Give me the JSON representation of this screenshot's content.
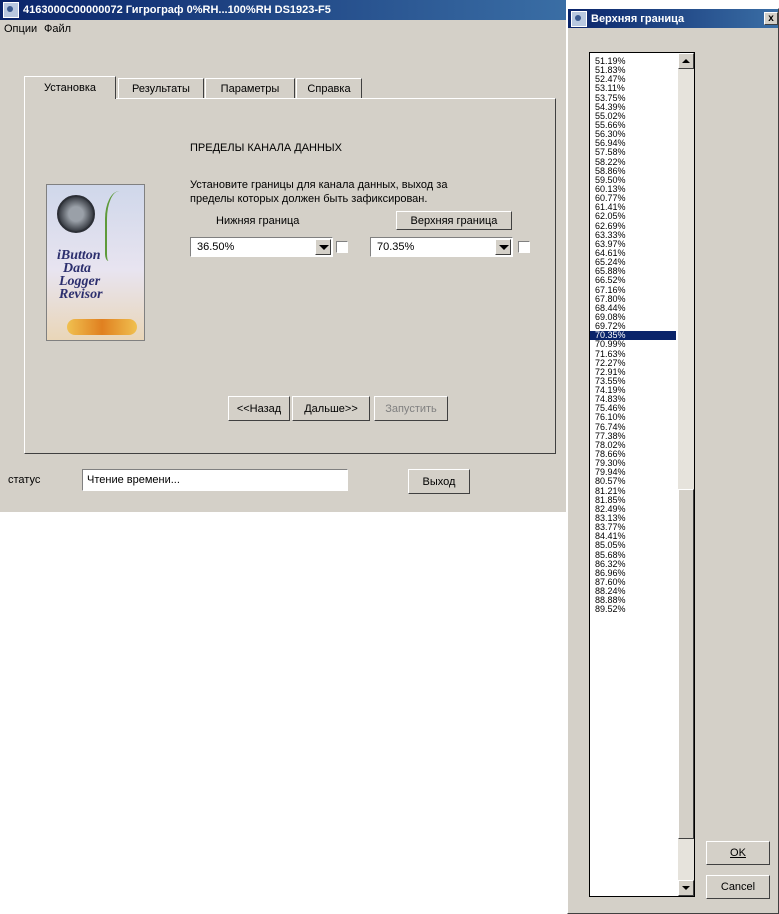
{
  "main_window": {
    "title": "4163000C00000072   Гигрограф 0%RH...100%RH   DS1923-F5",
    "menu": [
      "Опции",
      "Файл"
    ],
    "tabs": [
      "Установка",
      "Результаты",
      "Параметры",
      "Справка"
    ],
    "active_tab": "Установка",
    "section_title": "ПРЕДЕЛЫ КАНАЛА ДАННЫХ",
    "instructions_line1": "Установите границы для канала данных, выход за",
    "instructions_line2": "пределы которых должен быть зафиксирован.",
    "lower_label": "Нижняя граница",
    "upper_label": "Верхняя граница",
    "lower_value": "36.50%",
    "upper_value": "70.35%",
    "logo_lines": [
      "iButton",
      "Data",
      "Logger",
      "Revisor"
    ],
    "buttons": {
      "back": "<<Назад",
      "next": "Дальше>>",
      "run": "Запустить",
      "exit": "Выход"
    },
    "status_label": "статус",
    "status_text": "Чтение времени..."
  },
  "dialog": {
    "title": "Верхняя граница",
    "close_glyph": "x",
    "selected": "70.35%",
    "values": [
      "51.19%",
      "51.83%",
      "52.47%",
      "53.11%",
      "53.75%",
      "54.39%",
      "55.02%",
      "55.66%",
      "56.30%",
      "56.94%",
      "57.58%",
      "58.22%",
      "58.86%",
      "59.50%",
      "60.13%",
      "60.77%",
      "61.41%",
      "62.05%",
      "62.69%",
      "63.33%",
      "63.97%",
      "64.61%",
      "65.24%",
      "65.88%",
      "66.52%",
      "67.16%",
      "67.80%",
      "68.44%",
      "69.08%",
      "69.72%",
      "70.35%",
      "70.99%",
      "71.63%",
      "72.27%",
      "72.91%",
      "73.55%",
      "74.19%",
      "74.83%",
      "75.46%",
      "76.10%",
      "76.74%",
      "77.38%",
      "78.02%",
      "78.66%",
      "79.30%",
      "79.94%",
      "80.57%",
      "81.21%",
      "81.85%",
      "82.49%",
      "83.13%",
      "83.77%",
      "84.41%",
      "85.05%",
      "85.68%",
      "86.32%",
      "86.96%",
      "87.60%",
      "88.24%",
      "88.88%",
      "89.52%"
    ],
    "ok_label": "OK",
    "cancel_label": "Cancel"
  }
}
